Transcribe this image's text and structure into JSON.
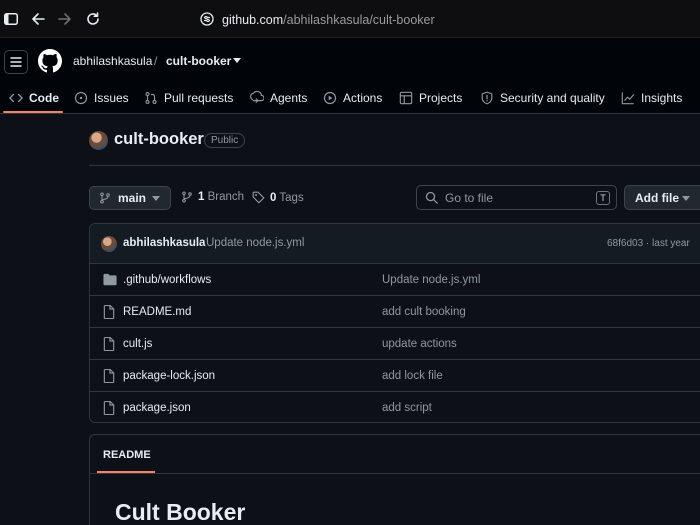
{
  "browser": {
    "url_host": "github.com",
    "url_path": "/abhilashkasula/cult-booker"
  },
  "header": {
    "owner": "abhilashkasula",
    "separator": "/",
    "repo": "cult-booker"
  },
  "tabs": [
    {
      "label": "Code",
      "icon": "code-icon",
      "active": true
    },
    {
      "label": "Issues",
      "icon": "issue-icon"
    },
    {
      "label": "Pull requests",
      "icon": "pull-request-icon"
    },
    {
      "label": "Agents",
      "icon": "agents-icon"
    },
    {
      "label": "Actions",
      "icon": "play-icon"
    },
    {
      "label": "Projects",
      "icon": "table-icon"
    },
    {
      "label": "Security and quality",
      "icon": "shield-icon"
    },
    {
      "label": "Insights",
      "icon": "graph-icon"
    }
  ],
  "repo": {
    "title": "cult-booker",
    "visibility": "Public"
  },
  "branch_bar": {
    "branch": "main",
    "branch_count": "1",
    "branch_label": "Branch",
    "tag_count": "0",
    "tag_label": "Tags",
    "goto_placeholder": "Go to file",
    "goto_shortcut": "T",
    "add_file": "Add file"
  },
  "latest_commit": {
    "author": "abhilashkasula",
    "message": "Update node.js.yml",
    "sha_time": "68f6d03 · last year"
  },
  "files": [
    {
      "name": ".github/workflows",
      "type": "folder",
      "commit": "Update node.js.yml"
    },
    {
      "name": "README.md",
      "type": "file",
      "commit": "add cult booking"
    },
    {
      "name": "cult.js",
      "type": "file",
      "commit": "update actions"
    },
    {
      "name": "package-lock.json",
      "type": "file",
      "commit": "add lock file"
    },
    {
      "name": "package.json",
      "type": "file",
      "commit": "add script"
    }
  ],
  "readme": {
    "tab": "README",
    "heading": "Cult Booker"
  },
  "colors": {
    "background": "#0d1117",
    "accent_underline": "#f78166",
    "border": "#30363d",
    "muted_text": "#9198a1"
  }
}
